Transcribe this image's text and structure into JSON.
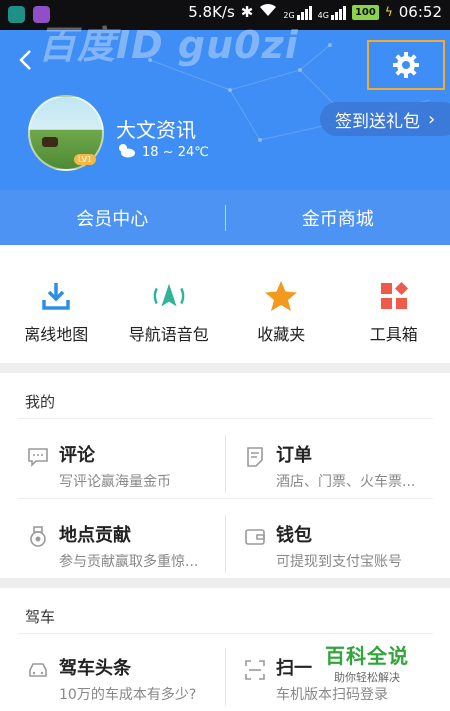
{
  "status_bar": {
    "speed": "5.8K/s",
    "net1": "2G",
    "net2": "4G",
    "battery": "100",
    "time": "06:52"
  },
  "watermark": "百度ID gu0zi",
  "header": {
    "user_name": "大文资讯",
    "level": "LV1",
    "weather": "18 ~ 24℃",
    "signin_label": "签到送礼包",
    "signin_chevron": "›"
  },
  "member_bar": {
    "member_center": "会员中心",
    "coin_mall": "金币商城"
  },
  "tools": [
    {
      "label": "离线地图",
      "icon": "download-icon",
      "color": "#2e8fe6"
    },
    {
      "label": "导航语音包",
      "icon": "navigation-voice-icon",
      "color": "#2fb39a"
    },
    {
      "label": "收藏夹",
      "icon": "star-icon",
      "color": "#f29a1d"
    },
    {
      "label": "工具箱",
      "icon": "toolbox-icon",
      "color": "#ef5a4a"
    }
  ],
  "mine": {
    "title": "我的",
    "items": [
      {
        "title": "评论",
        "subtitle": "写评论赢海量金币",
        "icon": "comment-icon"
      },
      {
        "title": "订单",
        "subtitle": "酒店、门票、火车票...",
        "icon": "order-icon"
      },
      {
        "title": "地点贡献",
        "subtitle": "参与贡献赢取多重惊...",
        "icon": "medal-icon"
      },
      {
        "title": "钱包",
        "subtitle": "可提现到支付宝账号",
        "icon": "wallet-icon"
      }
    ]
  },
  "driving": {
    "title": "驾车",
    "items": [
      {
        "title": "驾车头条",
        "subtitle": "10万的车成本有多少?",
        "icon": "car-icon"
      },
      {
        "title": "扫一",
        "subtitle": "车机版本扫码登录",
        "icon": "scan-icon"
      }
    ]
  },
  "brand": {
    "name": "百科全说",
    "slogan": "助你轻松解决"
  }
}
